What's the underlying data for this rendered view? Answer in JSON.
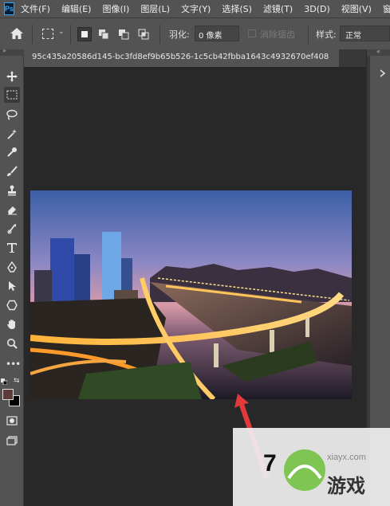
{
  "app": {
    "logo": "Ps"
  },
  "menu": [
    "文件(F)",
    "编辑(E)",
    "图像(I)",
    "图层(L)",
    "文字(Y)",
    "选择(S)",
    "滤镜(T)",
    "3D(D)",
    "视图(V)",
    "窗"
  ],
  "options": {
    "feather_label": "羽化:",
    "feather_value": "0 像素",
    "antialias_label": "消除锯齿",
    "style_label": "样式:",
    "style_value": "正常"
  },
  "document": {
    "tab_title": "95c435a20586d145-bc3fd8ef9b65b526-1c5cb42fbba1643c4932670ef408"
  },
  "icons": {
    "home": "home-icon",
    "marquee": "rect-marquee-icon",
    "selection_modes": [
      "new-selection-icon",
      "add-selection-icon",
      "subtract-selection-icon",
      "intersect-selection-icon"
    ]
  },
  "colors": {
    "foreground": "#5c3b3b",
    "background": "#000000",
    "ui_panel": "#535353",
    "canvas_bg": "#282828",
    "accent": "#31a8ff"
  },
  "watermark": {
    "site": "xiayx.com",
    "brand": "游戏",
    "number": "7"
  }
}
